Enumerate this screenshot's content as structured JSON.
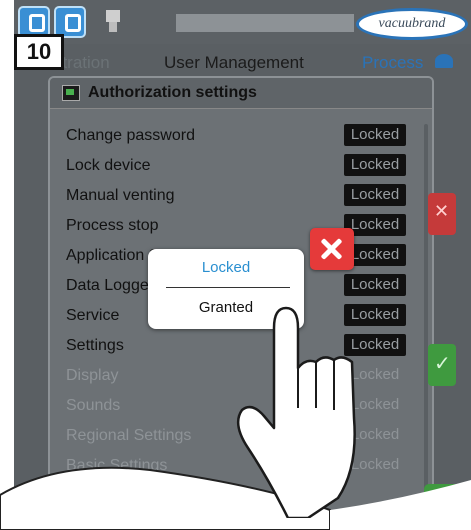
{
  "header": {
    "logo_text": "vacuubrand"
  },
  "step_badge": "10",
  "tabs": {
    "previous": "Administration",
    "current": "User Management",
    "process": "Process"
  },
  "panel": {
    "title": "Authorization settings",
    "rows": [
      {
        "label": "Change password",
        "value": "Locked",
        "enabled": true
      },
      {
        "label": "Lock device",
        "value": "Locked",
        "enabled": true
      },
      {
        "label": "Manual venting",
        "value": "Locked",
        "enabled": true
      },
      {
        "label": "Process stop",
        "value": "Locked",
        "enabled": true
      },
      {
        "label": "Application S",
        "value": "Locked",
        "enabled": true
      },
      {
        "label": "Data Logge",
        "value": "Locked",
        "enabled": true
      },
      {
        "label": "Service",
        "value": "Locked",
        "enabled": true
      },
      {
        "label": "Settings",
        "value": "Locked",
        "enabled": true
      },
      {
        "label": "Display",
        "value": "Locked",
        "enabled": false
      },
      {
        "label": "Sounds",
        "value": "Locked",
        "enabled": false
      },
      {
        "label": "Regional Settings",
        "value": "Locked",
        "enabled": false
      },
      {
        "label": "Basic Settings",
        "value": "Locked",
        "enabled": false
      }
    ]
  },
  "popup": {
    "option_locked": "Locked",
    "option_granted": "Granted"
  },
  "colors": {
    "accent": "#2a73b8",
    "close": "#e53a3a",
    "confirm": "#3f9a3f"
  }
}
